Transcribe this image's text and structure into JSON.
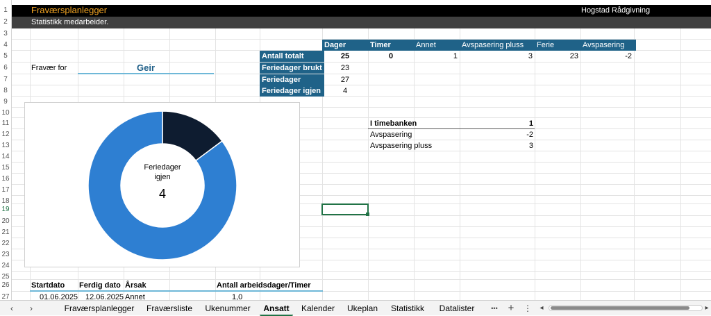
{
  "title": "Fraværsplanlegger",
  "company": "Hogstad Rådgivning",
  "subtitle": "Statistikk medarbeider.",
  "rows": [
    "1",
    "2",
    "3",
    "4",
    "5",
    "6",
    "7",
    "8",
    "9",
    "10",
    "11",
    "12",
    "13",
    "14",
    "15",
    "16",
    "17",
    "18",
    "19",
    "20",
    "21",
    "22",
    "23",
    "24",
    "25",
    "26",
    "27"
  ],
  "selected_row": "19",
  "absence_for_label": "Fravær for",
  "employee_name": "Geir",
  "summary": {
    "headers": [
      "Dager",
      "Timer",
      "Annet",
      "Avspasering pluss",
      "Ferie",
      "Avspasering"
    ],
    "row_labels": [
      "Antall totalt",
      "Feriedager brukt",
      "Feriedager",
      "Feriedager igjen"
    ],
    "total_values": [
      "25",
      "0",
      "1",
      "3",
      "23",
      "-2"
    ],
    "vacation_used": "23",
    "vacation_days": "27",
    "vacation_left": "4"
  },
  "timebank": {
    "label": "I timebanken",
    "value": "1",
    "rows": [
      {
        "label": "Avspasering",
        "value": "-2"
      },
      {
        "label": "Avspasering pluss",
        "value": "3"
      }
    ]
  },
  "donut": {
    "center_label_1": "Feriedager",
    "center_label_2": "igjen",
    "center_value": "4",
    "colors": {
      "used": "#2e7fd2",
      "left": "#0e1c30"
    }
  },
  "chart_data": {
    "type": "pie",
    "categories": [
      "Feriedager brukt",
      "Feriedager igjen"
    ],
    "values": [
      23,
      4
    ],
    "title": ""
  },
  "list": {
    "headers": [
      "Startdato",
      "Ferdig dato",
      "Årsak",
      "Antall arbeidsdager/Timer"
    ],
    "row1": [
      "01.06.2025",
      "12.06.2025",
      "Annet",
      "1,0"
    ]
  },
  "sheet_tabs": [
    {
      "label": "Fraværsplanlegger",
      "color": "#f4b6a5"
    },
    {
      "label": "Fraværsliste",
      "color": "#a9d98f"
    },
    {
      "label": "Ukenummer",
      "color": "#6fc25b"
    },
    {
      "label": "Ansatt",
      "color": "#ffffff"
    },
    {
      "label": "Kalender",
      "color": "#ffc000"
    },
    {
      "label": "Ukeplan",
      "color": "#ffc000"
    },
    {
      "label": "Statistikk",
      "color": "#ffc000"
    },
    {
      "label": "Datalister",
      "color": "#f4b6a5"
    }
  ],
  "nav": {
    "prev": "‹",
    "next": "›",
    "more": "•••",
    "add": "+",
    "menu": "⋮",
    "scroll_left": "◂",
    "scroll_right": "▸"
  }
}
